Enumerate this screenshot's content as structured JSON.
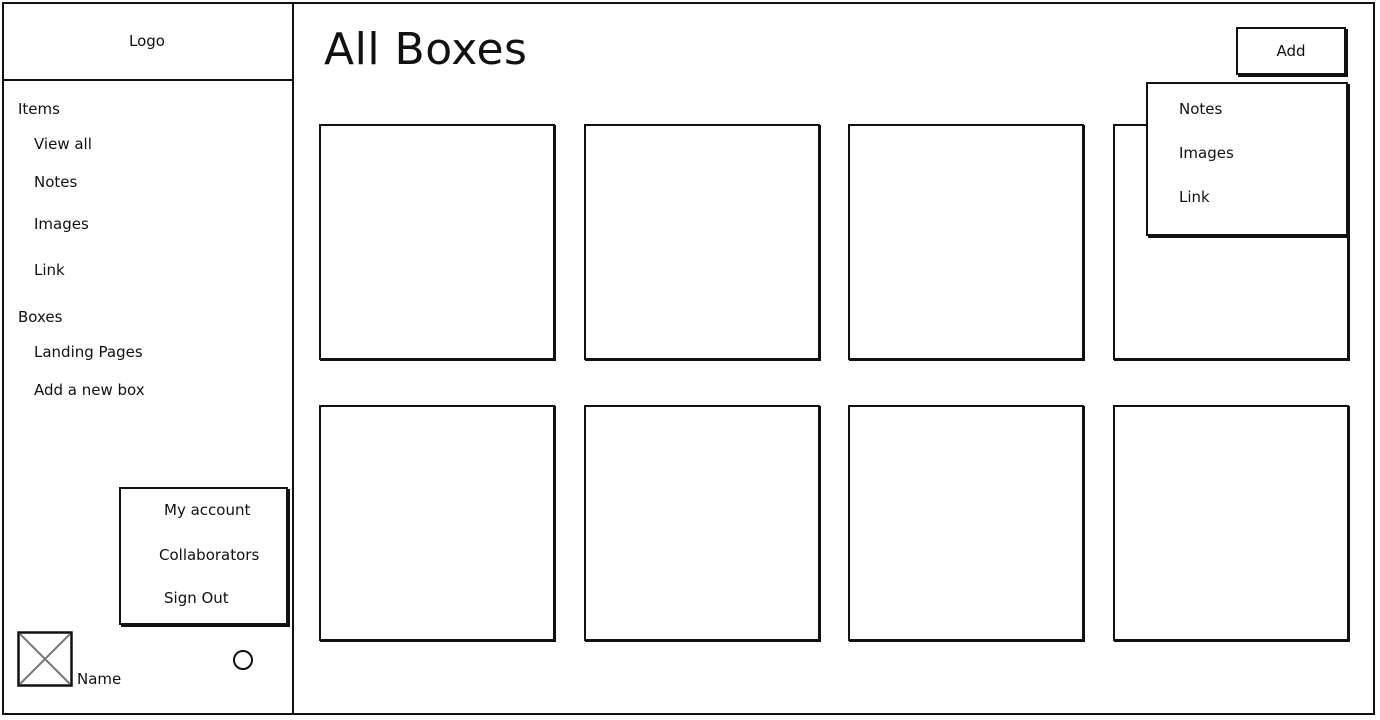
{
  "sidebar": {
    "logo": "Logo",
    "sections": [
      {
        "label": "Items",
        "items": [
          "View all",
          "Notes",
          "Images",
          "Link"
        ]
      },
      {
        "label": "Boxes",
        "items": [
          "Landing Pages",
          "Add a new box"
        ]
      }
    ]
  },
  "account_menu": {
    "items": [
      "My account",
      "Collaborators",
      "Sign Out"
    ]
  },
  "user": {
    "name": "Name"
  },
  "main": {
    "title": "All Boxes",
    "add_button": "Add",
    "add_menu": {
      "items": [
        "Notes",
        "Images",
        "Link"
      ]
    },
    "box_count": 8
  }
}
